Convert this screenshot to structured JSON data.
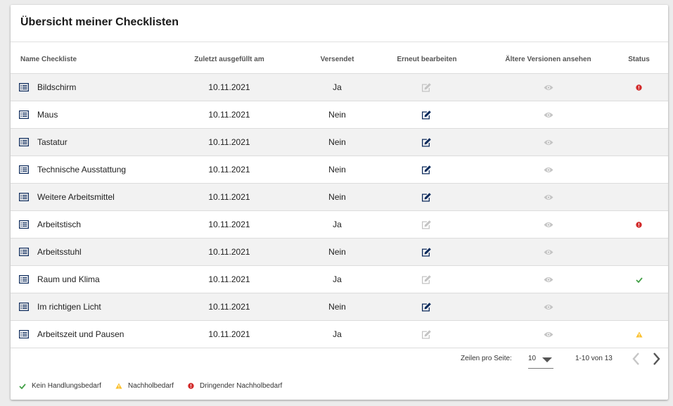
{
  "title": "Übersicht meiner Checklisten",
  "columns": {
    "name": "Name Checkliste",
    "last_filled": "Zuletzt ausgefüllt am",
    "sent": "Versendet",
    "edit": "Erneut bearbeiten",
    "versions": "Ältere Versionen ansehen",
    "status": "Status"
  },
  "rows": [
    {
      "name": "Bildschirm",
      "date": "10.11.2021",
      "sent": "Ja",
      "edit_enabled": false,
      "status": "urgent"
    },
    {
      "name": "Maus",
      "date": "10.11.2021",
      "sent": "Nein",
      "edit_enabled": true,
      "status": "none"
    },
    {
      "name": "Tastatur",
      "date": "10.11.2021",
      "sent": "Nein",
      "edit_enabled": true,
      "status": "none"
    },
    {
      "name": "Technische Ausstattung",
      "date": "10.11.2021",
      "sent": "Nein",
      "edit_enabled": true,
      "status": "none"
    },
    {
      "name": "Weitere Arbeitsmittel",
      "date": "10.11.2021",
      "sent": "Nein",
      "edit_enabled": true,
      "status": "none"
    },
    {
      "name": "Arbeitstisch",
      "date": "10.11.2021",
      "sent": "Ja",
      "edit_enabled": false,
      "status": "urgent"
    },
    {
      "name": "Arbeitsstuhl",
      "date": "10.11.2021",
      "sent": "Nein",
      "edit_enabled": true,
      "status": "none"
    },
    {
      "name": "Raum und Klima",
      "date": "10.11.2021",
      "sent": "Ja",
      "edit_enabled": false,
      "status": "ok"
    },
    {
      "name": "Im richtigen Licht",
      "date": "10.11.2021",
      "sent": "Nein",
      "edit_enabled": true,
      "status": "none"
    },
    {
      "name": "Arbeitszeit und Pausen",
      "date": "10.11.2021",
      "sent": "Ja",
      "edit_enabled": false,
      "status": "warning"
    }
  ],
  "pagination": {
    "rows_per_page_label": "Zeilen pro Seite:",
    "rows_per_page": "10",
    "range": "1-10 von 13"
  },
  "legend": [
    {
      "status": "ok",
      "label": "Kein Handlungsbedarf"
    },
    {
      "status": "warning",
      "label": "Nachholbedarf"
    },
    {
      "status": "urgent",
      "label": "Dringender Nachholbedarf"
    }
  ],
  "colors": {
    "ok": "#43a047",
    "warning": "#fbc02d",
    "urgent": "#d32f2f",
    "edit_active": "#0d2b5c",
    "edit_disabled": "#c4c4c4",
    "eye": "#c4c4c4",
    "list_icon": "#0d2b5c"
  },
  "icons": {
    "row": "list-icon",
    "edit": "edit-icon",
    "versions": "eye-icon",
    "prev": "chevron-left-icon",
    "next": "chevron-right-icon",
    "dropdown": "caret-down-icon"
  }
}
